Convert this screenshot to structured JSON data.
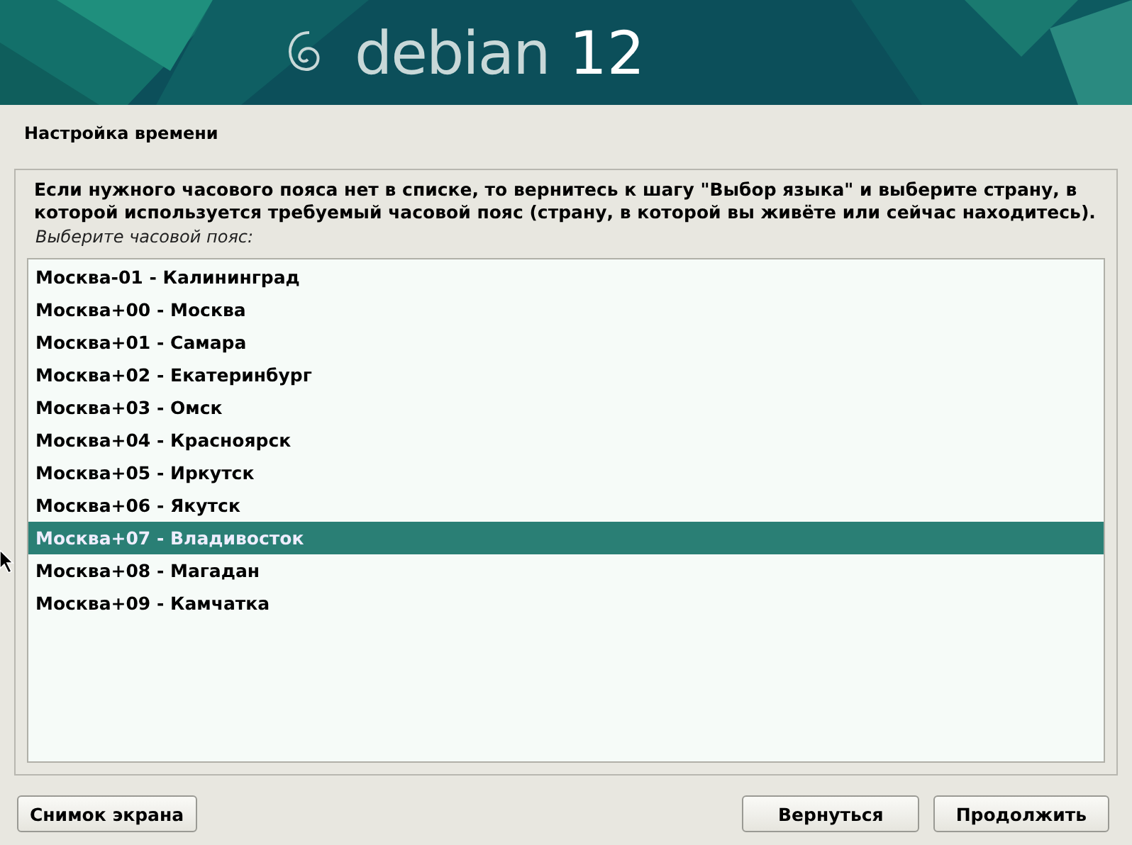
{
  "banner": {
    "logo_text": "debian",
    "version": "12"
  },
  "title": "Настройка времени",
  "description": "Если нужного часового пояса нет в списке, то вернитесь к шагу \"Выбор языка\" и выберите страну, в которой используется требуемый часовой пояс (страну, в которой вы живёте или сейчас находитесь).",
  "prompt": "Выберите часовой пояс:",
  "timezones": [
    {
      "label": "Москва-01 - Калининград",
      "selected": false
    },
    {
      "label": "Москва+00 - Москва",
      "selected": false
    },
    {
      "label": "Москва+01 - Самара",
      "selected": false
    },
    {
      "label": "Москва+02 - Екатеринбург",
      "selected": false
    },
    {
      "label": "Москва+03 - Омск",
      "selected": false
    },
    {
      "label": "Москва+04 - Красноярск",
      "selected": false
    },
    {
      "label": "Москва+05 - Иркутск",
      "selected": false
    },
    {
      "label": "Москва+06 - Якутск",
      "selected": false
    },
    {
      "label": "Москва+07 - Владивосток",
      "selected": true
    },
    {
      "label": "Москва+08 - Магадан",
      "selected": false
    },
    {
      "label": "Москва+09 - Камчатка",
      "selected": false
    }
  ],
  "buttons": {
    "screenshot": "Снимок экрана",
    "back": "Вернуться",
    "continue": "Продолжить"
  }
}
